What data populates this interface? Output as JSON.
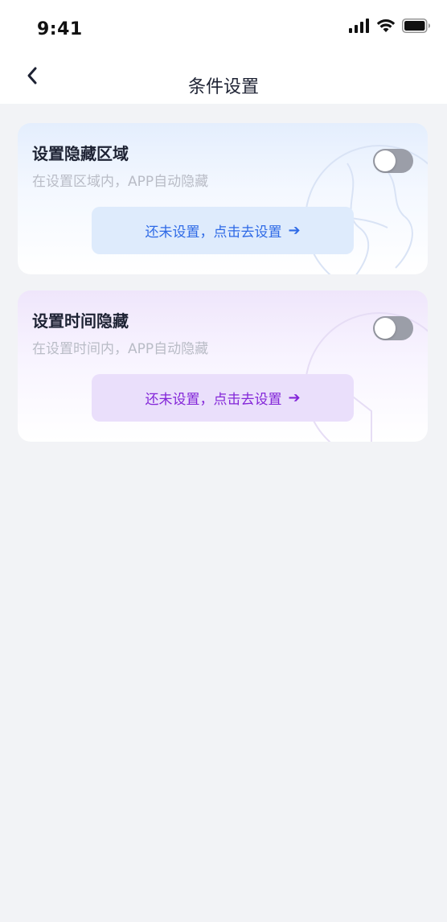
{
  "status_bar": {
    "time": "9:41",
    "icons": [
      "signal-icon",
      "wifi-icon",
      "battery-icon"
    ]
  },
  "nav": {
    "back_icon": "chevron-left-icon",
    "title": "条件设置"
  },
  "cards": [
    {
      "title": "设置隐藏区域",
      "subtitle": "在设置区域内，APP自动隐藏",
      "toggle_on": false,
      "button_label": "还未设置，点击去设置",
      "button_icon": "arrow-right-icon",
      "accent_color": "#2e6ae6"
    },
    {
      "title": "设置时间隐藏",
      "subtitle": "在设置时间内，APP自动隐藏",
      "toggle_on": false,
      "button_label": "还未设置，点击去设置",
      "button_icon": "arrow-right-icon",
      "accent_color": "#8325d8"
    }
  ],
  "colors": {
    "background": "#f2f3f6",
    "toggle_off": "#9b9ea8",
    "title_text": "#1d2233",
    "subtitle_text": "#b9bcc6"
  }
}
